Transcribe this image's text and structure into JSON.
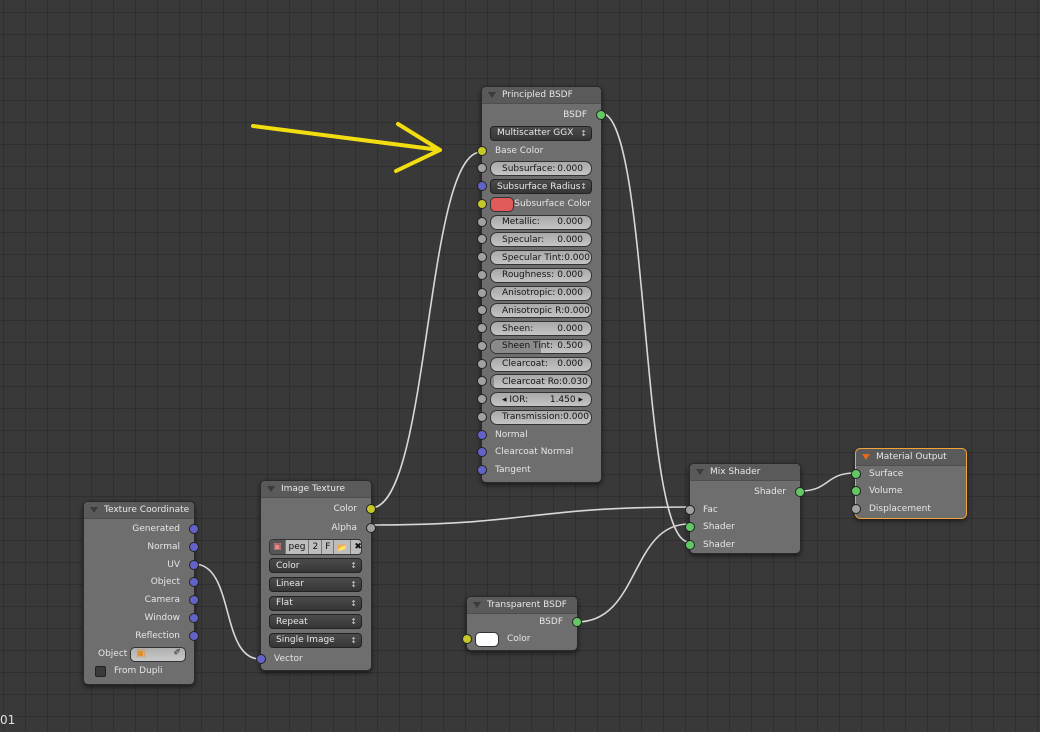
{
  "socket_colors": {
    "color": "#c7c729",
    "float": "#a1a1a1",
    "vector": "#6363c7",
    "shader": "#63c763"
  },
  "frame_label": "01",
  "nodes": {
    "principled": {
      "title": "Principled BSDF",
      "rows": [
        {
          "t": "out",
          "label": "BSDF",
          "s": "shader"
        },
        {
          "t": "select",
          "label": "Multiscatter GGX"
        },
        {
          "t": "in",
          "label": "Base Color",
          "s": "color"
        },
        {
          "t": "field",
          "label": "Subsurface:",
          "value": "0.000",
          "fill": 0,
          "s": "float"
        },
        {
          "t": "select",
          "label": "Subsurface Radius",
          "s": "vector"
        },
        {
          "t": "color",
          "label": "Subsurface Color",
          "color": "#e05a5a",
          "s": "color"
        },
        {
          "t": "field",
          "label": "Metallic:",
          "value": "0.000",
          "fill": 0,
          "s": "float"
        },
        {
          "t": "field",
          "label": "Specular:",
          "value": "0.000",
          "fill": 0,
          "s": "float"
        },
        {
          "t": "field",
          "label": "Specular Tint:",
          "value": "0.000",
          "fill": 0,
          "s": "float"
        },
        {
          "t": "field",
          "label": "Roughness:",
          "value": "0.000",
          "fill": 0,
          "s": "float"
        },
        {
          "t": "field",
          "label": "Anisotropic:",
          "value": "0.000",
          "fill": 0,
          "s": "float"
        },
        {
          "t": "field",
          "label": "Anisotropic R:",
          "value": "0.000",
          "fill": 0,
          "s": "float"
        },
        {
          "t": "field",
          "label": "Sheen:",
          "value": "0.000",
          "fill": 0,
          "s": "float"
        },
        {
          "t": "field",
          "label": "Sheen Tint:",
          "value": "0.500",
          "fill": 0.5,
          "s": "float"
        },
        {
          "t": "field",
          "label": "Clearcoat:",
          "value": "0.000",
          "fill": 0,
          "s": "float"
        },
        {
          "t": "field",
          "label": "Clearcoat Ro:",
          "value": "0.030",
          "fill": 0.03,
          "s": "float"
        },
        {
          "t": "field",
          "label": "◂ IOR:",
          "value": "1.450 ▸",
          "fill": 0,
          "s": "float"
        },
        {
          "t": "field",
          "label": "Transmission:",
          "value": "0.000",
          "fill": 0,
          "s": "float"
        },
        {
          "t": "in",
          "label": "Normal",
          "s": "vector"
        },
        {
          "t": "in",
          "label": "Clearcoat Normal",
          "s": "vector"
        },
        {
          "t": "in",
          "label": "Tangent",
          "s": "vector"
        }
      ]
    },
    "image": {
      "title": "Image Texture",
      "rows": [
        {
          "t": "out",
          "label": "Color",
          "s": "color"
        },
        {
          "t": "out",
          "label": "Alpha",
          "s": "float"
        },
        {
          "t": "imgbar",
          "name": "peg",
          "users": "2",
          "fake": "F"
        },
        {
          "t": "select",
          "label": "Color"
        },
        {
          "t": "select",
          "label": "Linear"
        },
        {
          "t": "select",
          "label": "Flat"
        },
        {
          "t": "select",
          "label": "Repeat"
        },
        {
          "t": "select",
          "label": "Single Image"
        },
        {
          "t": "in",
          "label": "Vector",
          "s": "vector"
        }
      ]
    },
    "texcoord": {
      "title": "Texture Coordinate",
      "rows": [
        {
          "t": "out",
          "label": "Generated",
          "s": "vector"
        },
        {
          "t": "out",
          "label": "Normal",
          "s": "vector"
        },
        {
          "t": "out",
          "label": "UV",
          "s": "vector"
        },
        {
          "t": "out",
          "label": "Object",
          "s": "vector"
        },
        {
          "t": "out",
          "label": "Camera",
          "s": "vector"
        },
        {
          "t": "out",
          "label": "Window",
          "s": "vector"
        },
        {
          "t": "out",
          "label": "Reflection",
          "s": "vector"
        },
        {
          "t": "obj",
          "label": "Object"
        },
        {
          "t": "check",
          "label": "From Dupli"
        }
      ]
    },
    "transparent": {
      "title": "Transparent BSDF",
      "rows": [
        {
          "t": "out",
          "label": "BSDF",
          "s": "shader"
        },
        {
          "t": "color",
          "label": "Color",
          "color": "#ffffff",
          "s": "color",
          "left": true
        }
      ]
    },
    "mix": {
      "title": "Mix Shader",
      "rows": [
        {
          "t": "out",
          "label": "Shader",
          "s": "shader"
        },
        {
          "t": "in",
          "label": "Fac",
          "s": "float"
        },
        {
          "t": "in",
          "label": "Shader",
          "s": "shader"
        },
        {
          "t": "in",
          "label": "Shader",
          "s": "shader"
        }
      ]
    },
    "output": {
      "title": "Material Output",
      "active": true,
      "rows": [
        {
          "t": "in",
          "label": "Surface",
          "s": "shader"
        },
        {
          "t": "in",
          "label": "Volume",
          "s": "shader"
        },
        {
          "t": "in",
          "label": "Displacement",
          "s": "float"
        }
      ]
    }
  }
}
